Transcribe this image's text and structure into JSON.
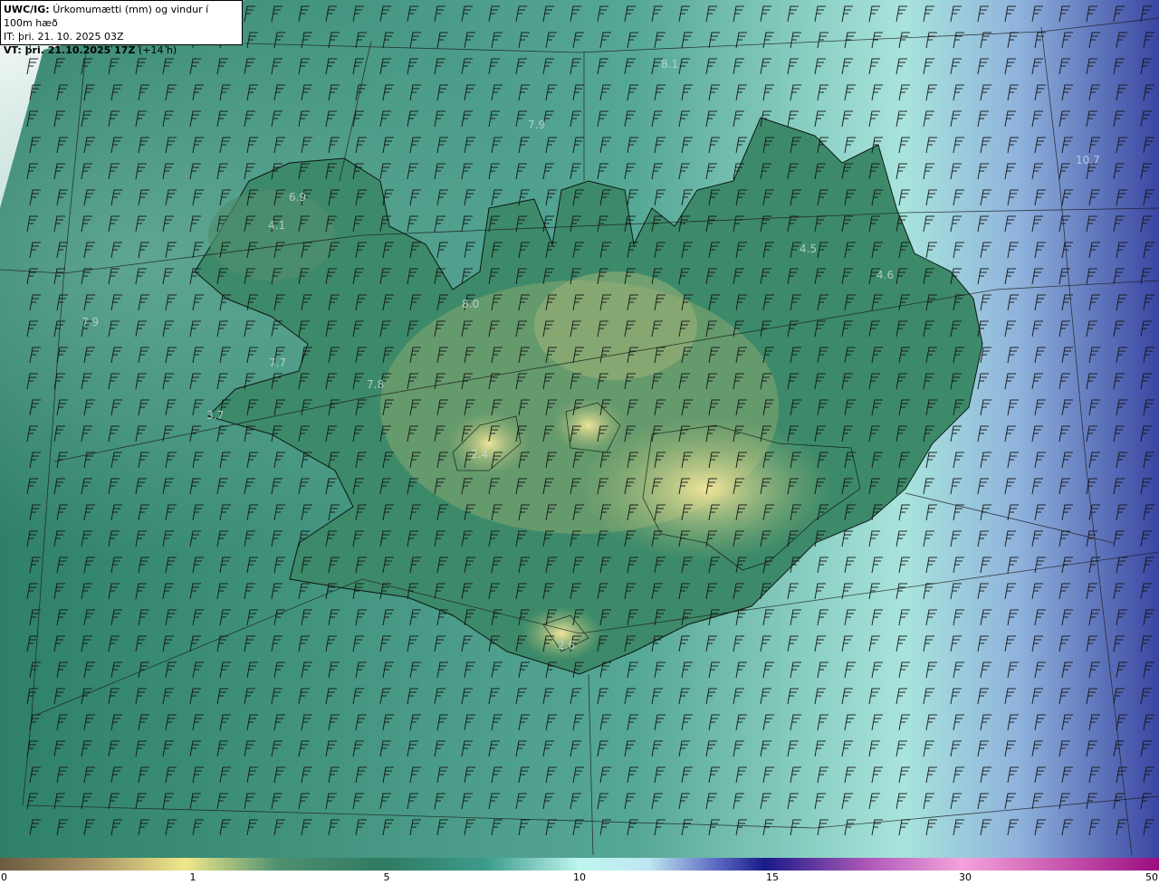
{
  "header": {
    "model": "UWC/IG:",
    "title": "Úrkomumætti (mm) og vindur í 100m hæð",
    "it_label": "IT: þri. 21. 10. 2025 03Z",
    "vt_label_bold": "VT: þri. 21.10.2025 17Z",
    "vt_offset": "(+14 h)"
  },
  "colorbar": {
    "ticks": [
      "0",
      "1",
      "5",
      "10",
      "15",
      "30",
      "50"
    ],
    "colors": [
      "#6b5a3e",
      "#c9b679",
      "#f0e88a",
      "#2f7a62",
      "#3d9c8c",
      "#bff6f0",
      "#bfe6f2",
      "#5866c0",
      "#1a1a8a",
      "#b05ab8",
      "#f5a2dc",
      "#9a0d80"
    ]
  },
  "map": {
    "value_labels": [
      "8.1",
      "7.9",
      "6.9",
      "4.1",
      "4.5",
      "4.6",
      "10.7",
      "7.9",
      "8.0",
      "7.7",
      "7.8",
      "3.7",
      "2.4",
      "2.6"
    ],
    "colors": {
      "land_low": "#2f7a62",
      "land_high": "#d9d78a",
      "sea_light": "#bfe9e4",
      "sea_dark": "#3a48a0",
      "coast": "#000000",
      "barb": "#101010"
    }
  }
}
